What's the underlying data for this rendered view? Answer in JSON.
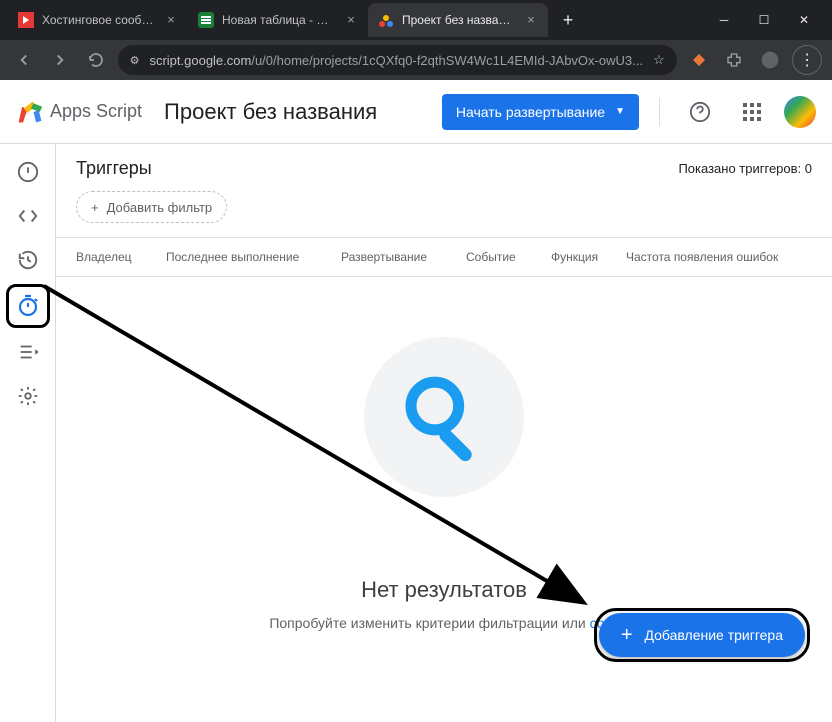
{
  "browser": {
    "tabs": [
      {
        "title": "Хостинговое сообщество"
      },
      {
        "title": "Новая таблица - Google Т"
      },
      {
        "title": "Проект без названия - Три",
        "active": true
      }
    ],
    "url_host": "script.google.com",
    "url_path": "/u/0/home/projects/1cQXfq0-f2qthSW4Wc1L4EMId-JAbvOx-owU3..."
  },
  "header": {
    "logo_text": "Apps Script",
    "project_title": "Проект без названия",
    "deploy_label": "Начать развертывание"
  },
  "page": {
    "title": "Триггеры",
    "count_label": "Показано триггеров: 0",
    "add_filter_label": "Добавить фильтр",
    "columns": {
      "owner": "Владелец",
      "last_run": "Последнее выполнение",
      "deployment": "Развертывание",
      "event": "Событие",
      "function": "Функция",
      "error_rate": "Частота появления ошибок"
    },
    "empty": {
      "title": "Нет результатов",
      "sub_prefix": "Попробуйте изменить критерии фильтрации или ",
      "link": "созд"
    },
    "fab_label": "Добавление триггера"
  }
}
